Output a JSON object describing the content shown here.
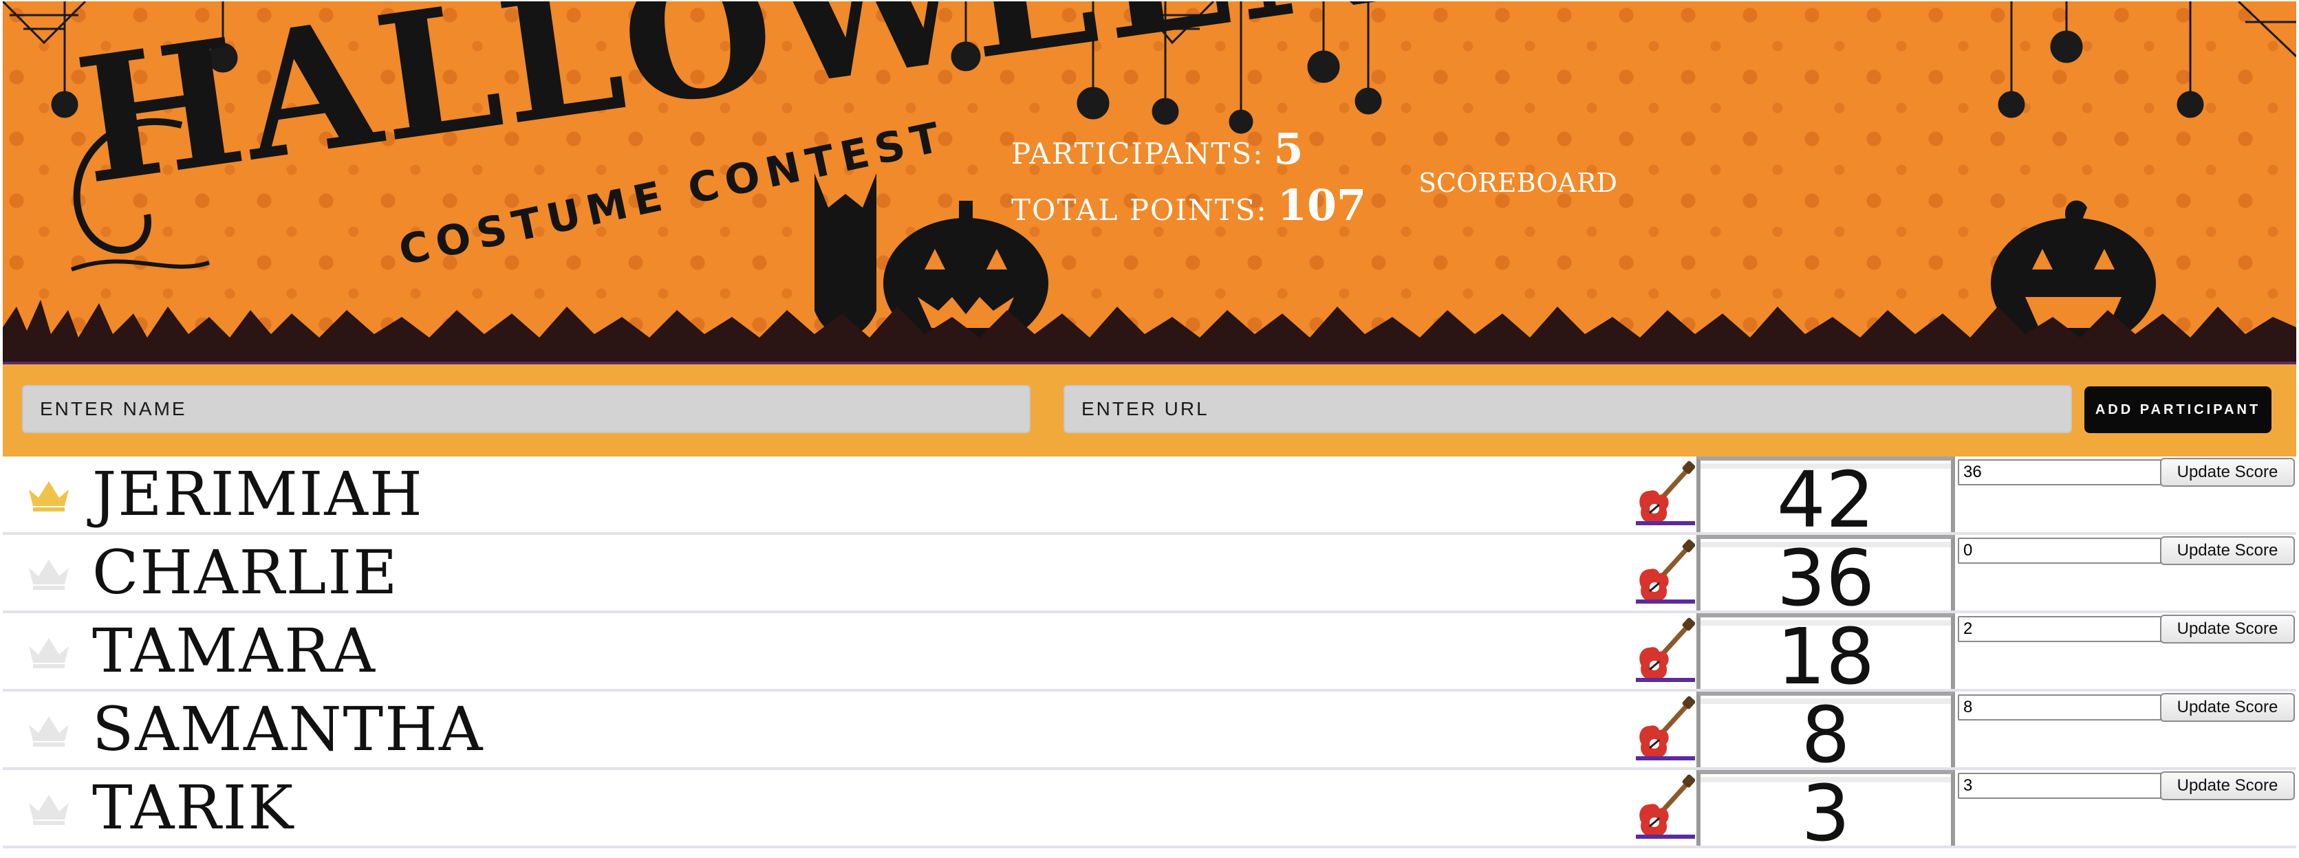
{
  "banner": {
    "logo_title": "HALLOWEEN",
    "logo_subtitle": "COSTUME CONTEST",
    "participants_label": "PARTICIPANTS:",
    "participants_value": "5",
    "total_points_label": "TOTAL POINTS:",
    "total_points_value": "107",
    "scoreboard_link": "SCOREBOARD"
  },
  "form": {
    "name_placeholder": "ENTER NAME",
    "url_placeholder": "ENTER URL",
    "add_button": "ADD PARTICIPANT"
  },
  "participants": [
    {
      "name": "JERIMIAH",
      "score": "42",
      "input_value": "36",
      "update_label": "Update Score",
      "leader": true
    },
    {
      "name": "CHARLIE",
      "score": "36",
      "input_value": "0",
      "update_label": "Update Score",
      "leader": false
    },
    {
      "name": "TAMARA",
      "score": "18",
      "input_value": "2",
      "update_label": "Update Score",
      "leader": false
    },
    {
      "name": "SAMANTHA",
      "score": "8",
      "input_value": "8",
      "update_label": "Update Score",
      "leader": false
    },
    {
      "name": "TARIK",
      "score": "3",
      "input_value": "3",
      "update_label": "Update Score",
      "leader": false
    }
  ],
  "icons": {
    "crown": "crown-icon",
    "guitar": "guitar-icon"
  },
  "colors": {
    "banner_orange": "#f08a2a",
    "form_bar": "#f2a93b",
    "crown_gold": "#f0c24a",
    "crown_gray": "#e6e6e6",
    "add_button_bg": "#0a0a0a"
  }
}
